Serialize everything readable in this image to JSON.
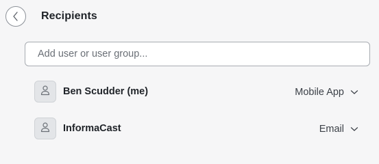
{
  "header": {
    "title": "Recipients"
  },
  "search": {
    "placeholder": "Add user or user group..."
  },
  "recipients": [
    {
      "name": "Ben Scudder (me)",
      "method": "Mobile App"
    },
    {
      "name": "InformaCast",
      "method": "Email"
    }
  ],
  "icons": {
    "back": "chevron-left-icon",
    "avatar": "person-icon",
    "dropdown": "chevron-down-icon"
  },
  "colors": {
    "background": "#f6f6f7",
    "text": "#1f2328",
    "border": "#a7abb1"
  }
}
